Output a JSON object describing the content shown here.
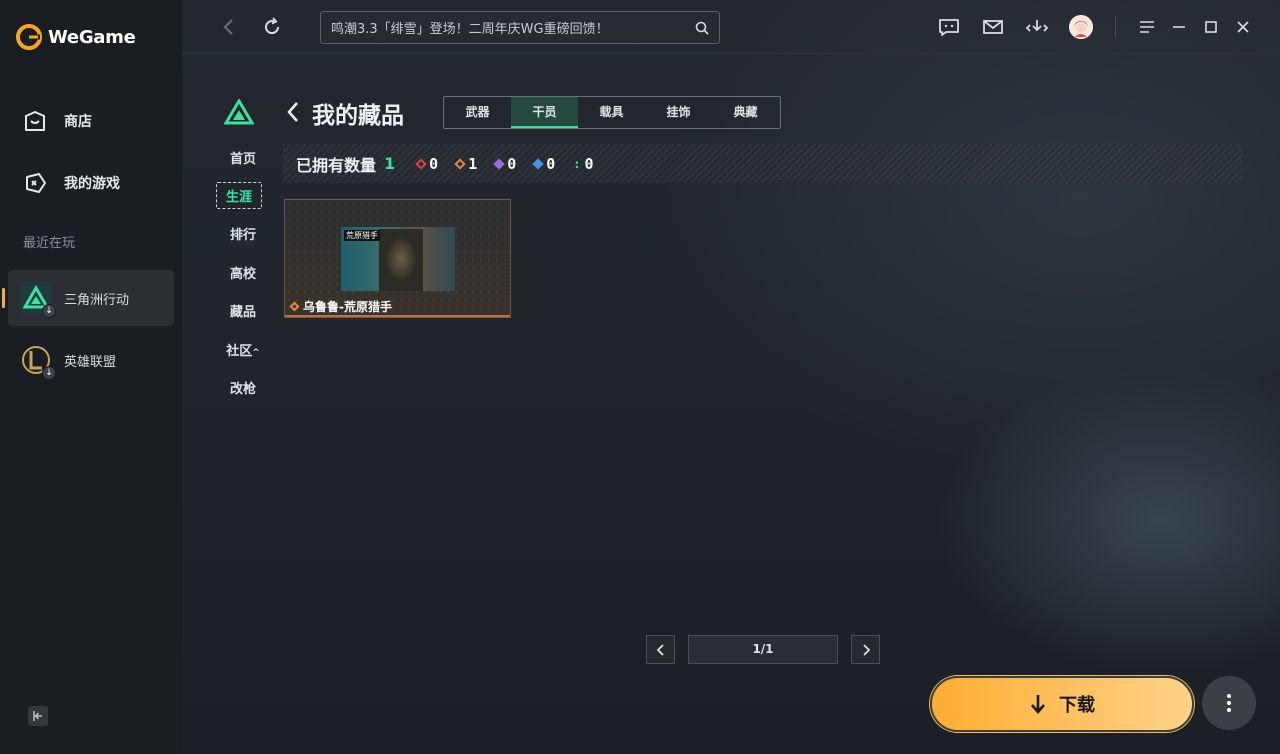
{
  "app": {
    "name": "WeGame"
  },
  "sidebar": {
    "nav": [
      {
        "label": "商店",
        "icon": "store-bag-icon"
      },
      {
        "label": "我的游戏",
        "icon": "gamepad-icon"
      }
    ],
    "recent_label": "最近在玩",
    "games": [
      {
        "label": "三角洲行动",
        "icon": "delta-force-icon",
        "active": true
      },
      {
        "label": "英雄联盟",
        "icon": "league-of-legends-icon",
        "active": false
      }
    ]
  },
  "topbar": {
    "search_text": "鸣潮3.3「绯雪」登场！二周年庆WG重磅回馈！"
  },
  "game_nav": {
    "items": [
      "首页",
      "生涯",
      "排行",
      "高校",
      "藏品",
      "社区",
      "改枪"
    ],
    "active": "生涯"
  },
  "page": {
    "title": "我的藏品",
    "tabs": [
      "武器",
      "干员",
      "载具",
      "挂饰",
      "典藏"
    ],
    "active_tab": "干员"
  },
  "stats": {
    "label": "已拥有数量",
    "total": "1",
    "items": [
      {
        "color": "#e0404a",
        "value": "0"
      },
      {
        "color": "#e08a3c",
        "value": "1"
      },
      {
        "color": "#9a6ee0",
        "value": "0"
      },
      {
        "color": "#4a90e0",
        "value": "0"
      },
      {
        "color": "#3ce0a0",
        "value": "0"
      }
    ]
  },
  "cards": [
    {
      "name": "乌鲁鲁-荒原猎手",
      "tag": "荒原猎手",
      "rarity_color": "#e08a3c"
    }
  ],
  "pagination": {
    "text": "1/1"
  },
  "download": {
    "label": "下载"
  }
}
